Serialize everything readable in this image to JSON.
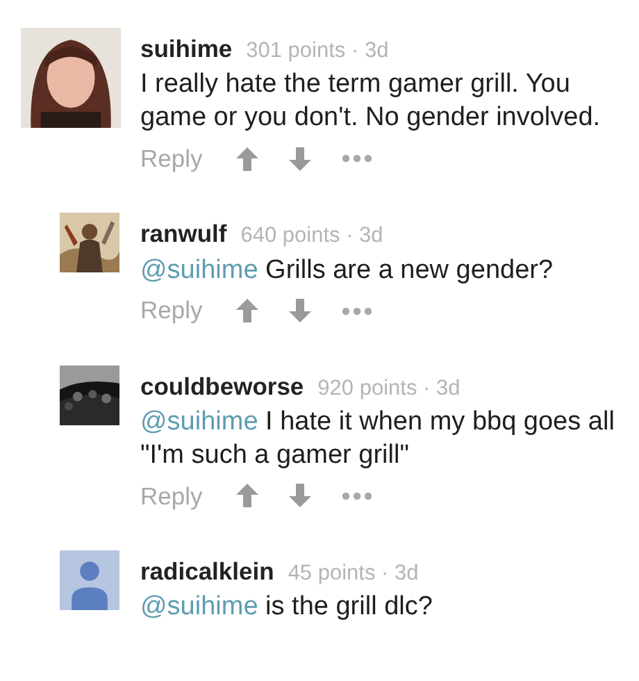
{
  "comments": [
    {
      "username": "suihime",
      "meta": "301 points · 3d",
      "text": "I really hate the term gamer grill. You game or you don't. No gender involved.",
      "reply": "Reply",
      "children": [
        {
          "username": "ranwulf",
          "meta": "640 points · 3d",
          "mention": "@suihime",
          "text": "Grills are a new gender?",
          "reply": "Reply"
        },
        {
          "username": "couldbeworse",
          "meta": "920 points · 3d",
          "mention": "@suihime",
          "text": "I hate it when my bbq goes all \"I'm such a gamer grill\"",
          "reply": "Reply"
        },
        {
          "avatar": {
            "kind": "default"
          },
          "username": "radicalklein",
          "meta": "45 points · 3d",
          "mention": "@suihime",
          "text": "is the grill dlc?"
        }
      ]
    }
  ]
}
